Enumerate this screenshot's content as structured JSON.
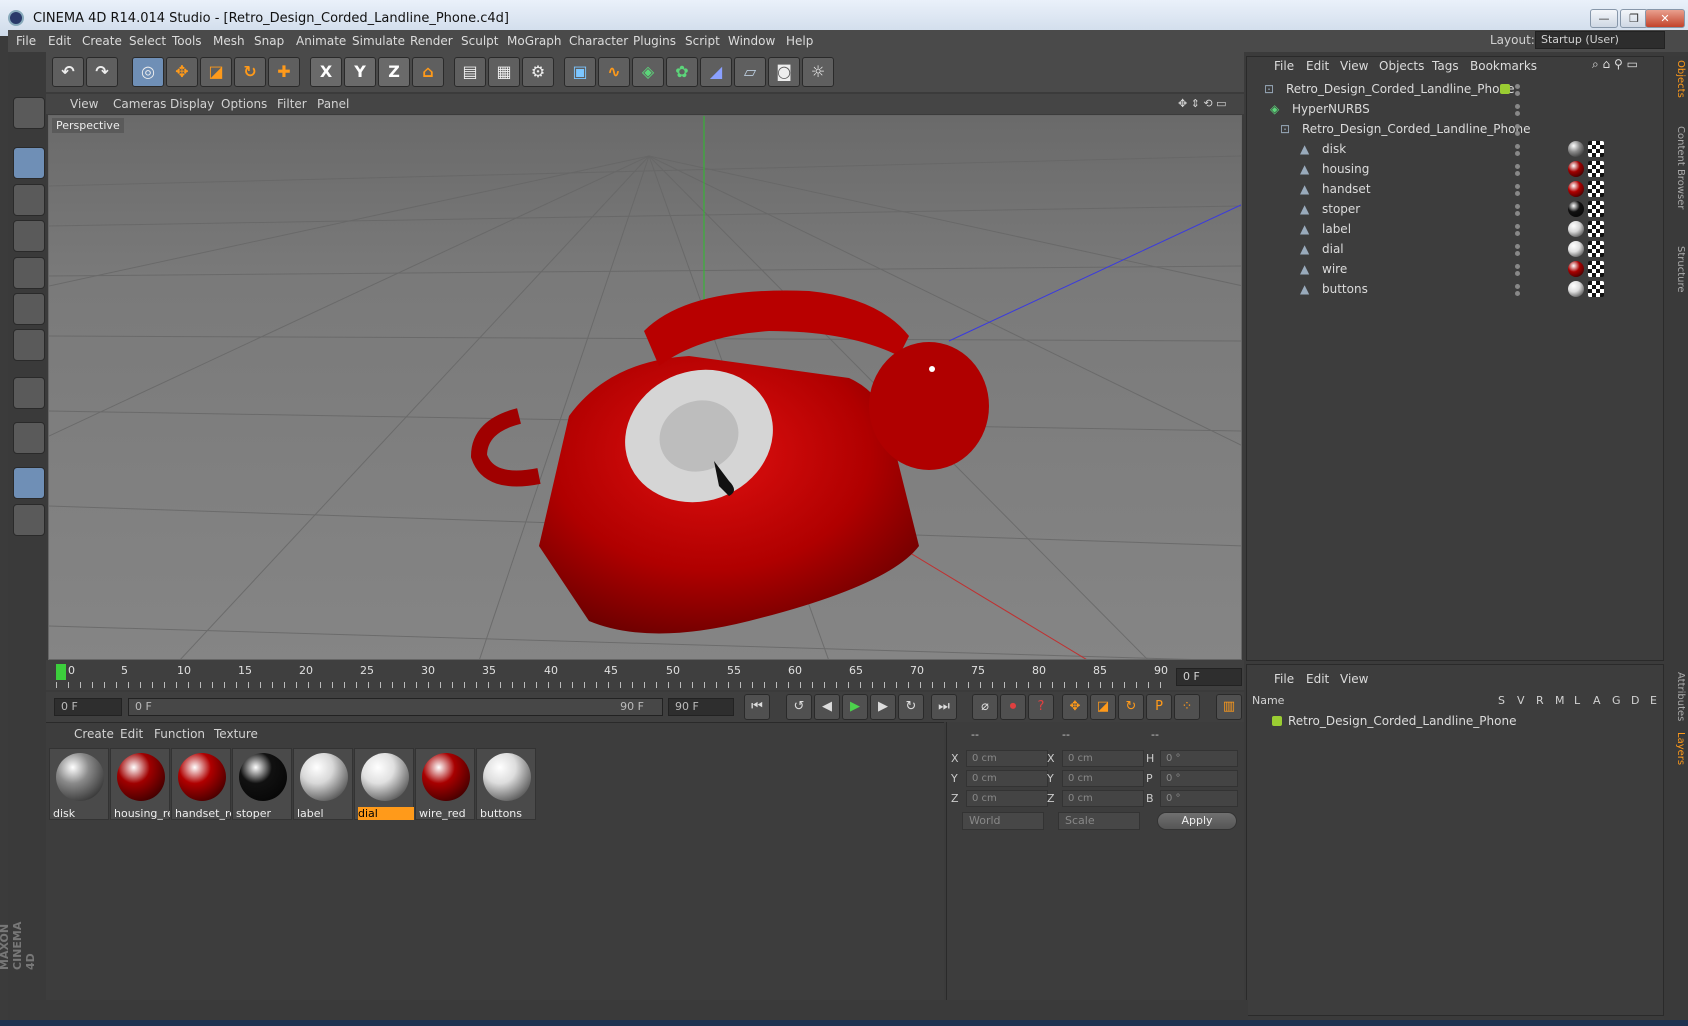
{
  "window": {
    "title": "CINEMA 4D R14.014 Studio - [Retro_Design_Corded_Landline_Phone.c4d]",
    "controls": {
      "minimize": "—",
      "restore": "❐",
      "close": "✕"
    }
  },
  "menubar": {
    "items": [
      "File",
      "Edit",
      "Create",
      "Select",
      "Tools",
      "Mesh",
      "Snap",
      "Animate",
      "Simulate",
      "Render",
      "Sculpt",
      "MoGraph",
      "Character",
      "Plugins",
      "Script",
      "Window",
      "Help"
    ],
    "layout_label": "Layout:",
    "layout_value": "Startup (User)"
  },
  "toolbar": {
    "axis_labels": [
      "X",
      "Y",
      "Z"
    ]
  },
  "viewport": {
    "menu": [
      "View",
      "Cameras",
      "Display",
      "Options",
      "Filter",
      "Panel"
    ],
    "label": "Perspective",
    "object_color": "#c00000",
    "bg_color": "#6e6e6e"
  },
  "timeline": {
    "ticks": [
      "0",
      "5",
      "10",
      "15",
      "20",
      "25",
      "30",
      "35",
      "40",
      "45",
      "50",
      "55",
      "60",
      "65",
      "70",
      "75",
      "80",
      "85",
      "90"
    ],
    "current_frame": "0 F",
    "start_field": "0 F",
    "range_start": "0 F",
    "range_end": "90 F",
    "end_field": "90 F"
  },
  "materials": {
    "menu": [
      "Create",
      "Edit",
      "Function",
      "Texture"
    ],
    "items": [
      {
        "name": "disk",
        "color": "#8a8a8a"
      },
      {
        "name": "housing_re",
        "color": "#a00000"
      },
      {
        "name": "handset_re",
        "color": "#b00000"
      },
      {
        "name": "stoper",
        "color": "#111111"
      },
      {
        "name": "label",
        "color": "#d8d8d8"
      },
      {
        "name": "dial",
        "color": "#e0e0e0"
      },
      {
        "name": "wire_red",
        "color": "#a80000"
      },
      {
        "name": "buttons",
        "color": "#dddddd"
      }
    ],
    "selected": "dial"
  },
  "attributes": {
    "header": [
      "--",
      "--",
      "--"
    ],
    "rows": [
      {
        "a": "X",
        "a_val": "0 cm",
        "b": "X",
        "b_val": "0 cm",
        "c": "H",
        "c_val": "0 °"
      },
      {
        "a": "Y",
        "a_val": "0 cm",
        "b": "Y",
        "b_val": "0 cm",
        "c": "P",
        "c_val": "0 °"
      },
      {
        "a": "Z",
        "a_val": "0 cm",
        "b": "Z",
        "b_val": "0 cm",
        "c": "B",
        "c_val": "0 °"
      }
    ],
    "coord_mode": "World",
    "scale_mode": "Scale",
    "apply_label": "Apply"
  },
  "objects_panel": {
    "menu": [
      "File",
      "Edit",
      "View",
      "Objects",
      "Tags",
      "Bookmarks"
    ],
    "tree": [
      {
        "name": "Retro_Design_Corded_Landline_Phone",
        "level": 0,
        "tag": "none"
      },
      {
        "name": "HyperNURBS",
        "level": 1,
        "tag": "none"
      },
      {
        "name": "Retro_Design_Corded_Landline_Phone",
        "level": 2,
        "tag": "none"
      },
      {
        "name": "disk",
        "level": 3,
        "tag": "#8a8a8a"
      },
      {
        "name": "housing",
        "level": 3,
        "tag": "#a00000"
      },
      {
        "name": "handset",
        "level": 3,
        "tag": "#b00000"
      },
      {
        "name": "stoper",
        "level": 3,
        "tag": "#111111"
      },
      {
        "name": "label",
        "level": 3,
        "tag": "#d8d8d8"
      },
      {
        "name": "dial",
        "level": 3,
        "tag": "#e0e0e0"
      },
      {
        "name": "wire",
        "level": 3,
        "tag": "#a80000"
      },
      {
        "name": "buttons",
        "level": 3,
        "tag": "#dddddd"
      }
    ]
  },
  "layers_panel": {
    "menu": [
      "File",
      "Edit",
      "View"
    ],
    "columns": [
      "Name",
      "S",
      "V",
      "R",
      "M",
      "L",
      "A",
      "G",
      "D",
      "E"
    ],
    "rows": [
      {
        "name": "Retro_Design_Corded_Landline_Phone",
        "color": "#9acd32"
      }
    ]
  },
  "side_tabs": [
    "Objects",
    "Content Browser",
    "Structure",
    "Attributes",
    "Layers"
  ],
  "brand": "MAXON CINEMA 4D"
}
